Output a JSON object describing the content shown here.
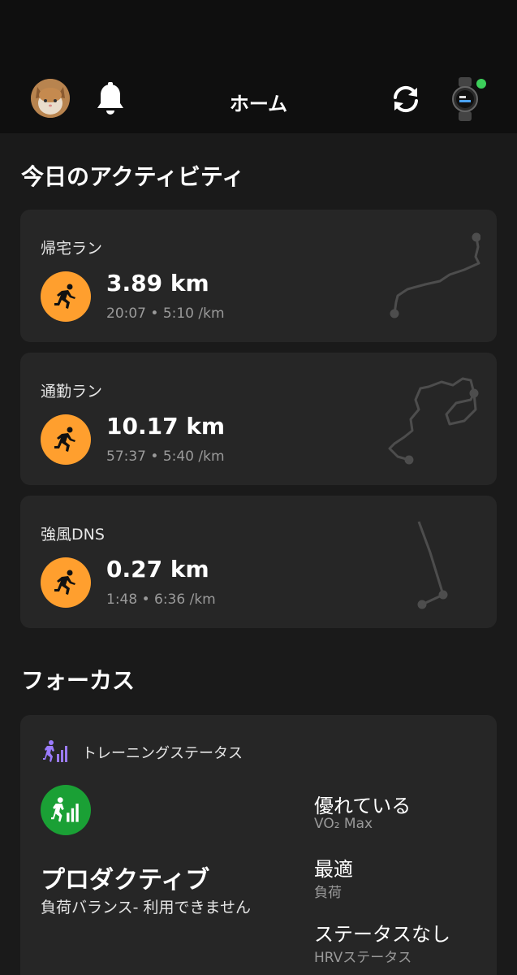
{
  "header": {
    "title": "ホーム",
    "avatar_icon": "profile-avatar",
    "bell_icon": "bell-icon",
    "sync_icon": "sync-icon",
    "watch_icon": "watch-icon",
    "watch_status_color": "#3ccf5a"
  },
  "today": {
    "section_title": "今日のアクティビティ",
    "activities": [
      {
        "name": "帰宅ラン",
        "distance": "3.89 km",
        "stats": "20:07 • 5:10 /km",
        "icon": "running-icon"
      },
      {
        "name": "通勤ラン",
        "distance": "10.17 km",
        "stats": "57:37 • 5:40 /km",
        "icon": "running-icon"
      },
      {
        "name": "強風DNS",
        "distance": "0.27 km",
        "stats": "1:48 • 6:36 /km",
        "icon": "running-icon"
      }
    ]
  },
  "focus": {
    "section_title": "フォーカス",
    "card_title": "トレーニングステータス",
    "status": "プロダクティブ",
    "status_sub": "負荷バランス- 利用できません",
    "metrics": [
      {
        "value": "優れている",
        "label": "VO₂ Max"
      },
      {
        "value": "最適",
        "label": "負荷"
      },
      {
        "value": "ステータスなし",
        "label": "HRVステータス"
      }
    ]
  },
  "colors": {
    "background": "#1a1a1a",
    "header_bg": "#0f0f0f",
    "card_bg": "#262626",
    "run_accent": "#ff9f2e",
    "status_green": "#1aa035",
    "training_purple": "#9b7bff"
  }
}
